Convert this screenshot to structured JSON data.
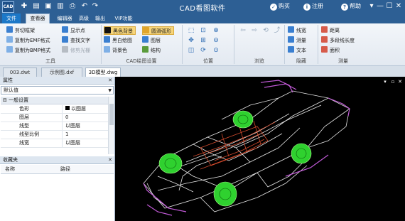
{
  "app": {
    "title": "CAD看图软件",
    "icon_text": "CAD",
    "links": [
      {
        "icon": "cart-icon",
        "label": "购买",
        "glyph": "✓"
      },
      {
        "icon": "user-icon",
        "label": "注册",
        "glyph": "i"
      },
      {
        "icon": "help-icon",
        "label": "帮助",
        "glyph": "?"
      }
    ],
    "window_controls": [
      "▾",
      "—",
      "☐",
      "✕"
    ]
  },
  "menu": {
    "tabs": [
      "文件",
      "查看器",
      "编辑器",
      "高级",
      "输出",
      "VIP功能"
    ],
    "active": "查看器"
  },
  "ribbon": {
    "groups": [
      {
        "label": "工具"
      },
      {
        "label": "CAD绘图设置"
      },
      {
        "label": "位置"
      },
      {
        "label": "浏览"
      },
      {
        "label": "隐藏"
      },
      {
        "label": "测量"
      }
    ],
    "tools": {
      "cut_frame": "剪切框架",
      "copy_emf": "复制为EMF格式",
      "copy_bmp": "复制为BMP格式",
      "show_points": "显示点",
      "find_text": "查找文字",
      "trim_raster": "修剪光栅"
    },
    "drawing": {
      "black_bg": "黑色背景",
      "black_white": "黑白绘图",
      "bg_color": "背景色",
      "smooth_arc": "圆滑弧形",
      "layers": "图层",
      "structure": "结构"
    },
    "hide": {
      "linewidth": "线宽",
      "measure": "测量",
      "text": "文本"
    },
    "measure": {
      "distance": "距离",
      "polyline_length": "多段线长度",
      "area": "面积"
    }
  },
  "doc_tabs": [
    {
      "label": "003.dwt",
      "active": false
    },
    {
      "label": "示例图.dxf",
      "active": false
    },
    {
      "label": "3D模型.dwg",
      "active": true
    }
  ],
  "properties": {
    "title": "属性",
    "close": "✕",
    "dropdown_value": "默认值",
    "group": "一般设置",
    "rows": [
      {
        "key": "色彩",
        "value": "以图层",
        "swatch": "#000000"
      },
      {
        "key": "图层",
        "value": "0"
      },
      {
        "key": "线型",
        "value": "以图层"
      },
      {
        "key": "线型比例",
        "value": "1"
      },
      {
        "key": "线宽",
        "value": "以图层"
      }
    ]
  },
  "favorites": {
    "title": "收藏夹",
    "columns": [
      "名称",
      "路径"
    ]
  },
  "canvas": {
    "background": "#000000",
    "colors": {
      "body": "#e6e6e6",
      "interior": "#d24a2c",
      "wheels": "#2fd12f",
      "trim": "#c25ad8"
    }
  }
}
